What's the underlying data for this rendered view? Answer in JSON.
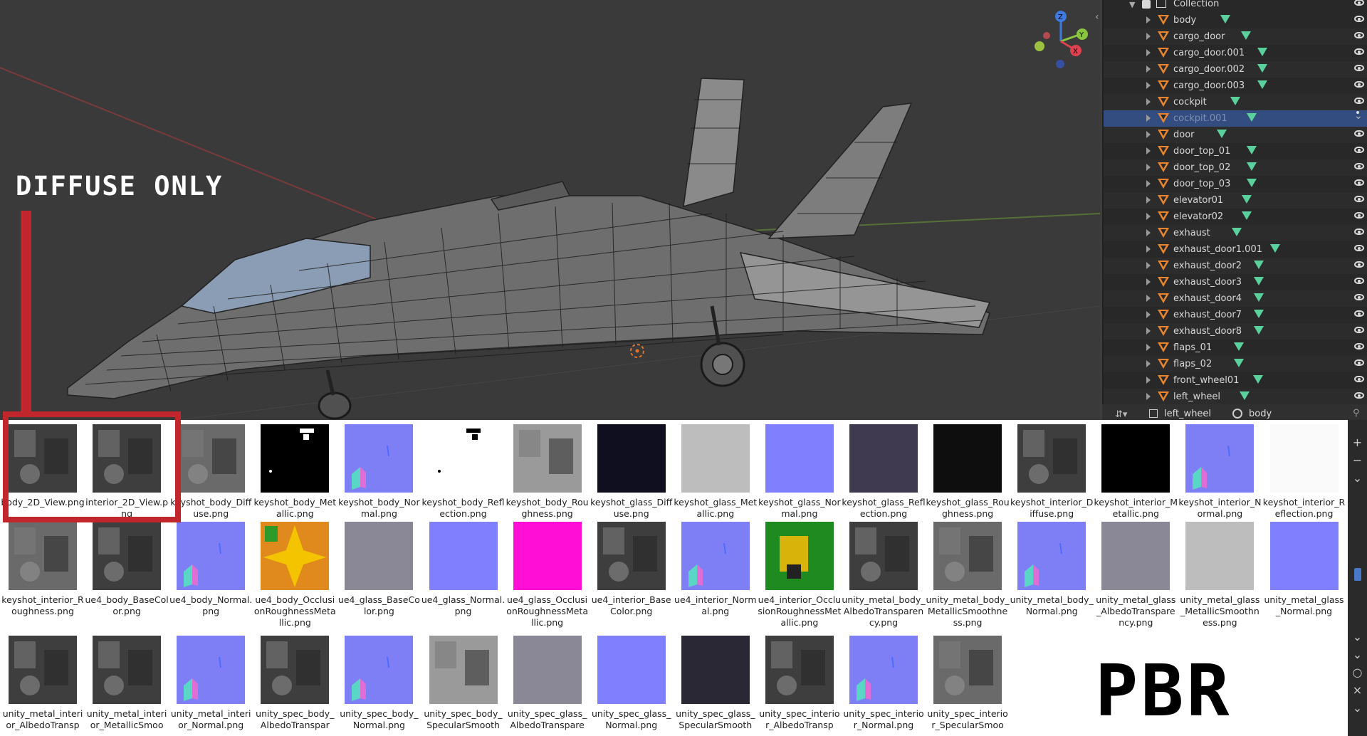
{
  "annotations": {
    "diffuse_title": "DIFFUSE ONLY",
    "pbr_title": "PBR"
  },
  "outliner": {
    "collection": "Collection",
    "items": [
      {
        "name": "body"
      },
      {
        "name": "cargo_door"
      },
      {
        "name": "cargo_door.001"
      },
      {
        "name": "cargo_door.002"
      },
      {
        "name": "cargo_door.003"
      },
      {
        "name": "cockpit"
      },
      {
        "name": "cockpit.001",
        "selected": true
      },
      {
        "name": "door"
      },
      {
        "name": "door_top_01"
      },
      {
        "name": "door_top_02"
      },
      {
        "name": "door_top_03"
      },
      {
        "name": "elevator01"
      },
      {
        "name": "elevator02"
      },
      {
        "name": "exhaust"
      },
      {
        "name": "exhaust_door1.001"
      },
      {
        "name": "exhaust_door2"
      },
      {
        "name": "exhaust_door3"
      },
      {
        "name": "exhaust_door4"
      },
      {
        "name": "exhaust_door7"
      },
      {
        "name": "exhaust_door8"
      },
      {
        "name": "flaps_01"
      },
      {
        "name": "flaps_02"
      },
      {
        "name": "front_wheel01"
      },
      {
        "name": "left_wheel"
      }
    ]
  },
  "properties_header": {
    "object": "left_wheel",
    "material": "body"
  },
  "files": {
    "row1": [
      {
        "name": "body_2D_View.png",
        "swatch": "gray_dark"
      },
      {
        "name": "interior_2D_View.png",
        "swatch": "gray_dark"
      },
      {
        "name": "keyshot_body_Diffuse.png",
        "swatch": "gray_mid"
      },
      {
        "name": "keyshot_body_Metallic.png",
        "swatch": "black_spots"
      },
      {
        "name": "keyshot_body_Normal.png",
        "swatch": "normal"
      },
      {
        "name": "keyshot_body_Reflection.png",
        "swatch": "white_spots"
      },
      {
        "name": "keyshot_body_Roughness.png",
        "swatch": "gray_light"
      },
      {
        "name": "keyshot_glass_Diffuse.png",
        "swatch": "navy_black"
      },
      {
        "name": "keyshot_glass_Metallic.png",
        "swatch": "silver"
      },
      {
        "name": "keyshot_glass_Normal.png",
        "swatch": "normal_flat"
      },
      {
        "name": "keyshot_glass_Reflection.png",
        "swatch": "slate"
      },
      {
        "name": "keyshot_glass_Roughness.png",
        "swatch": "near_black"
      },
      {
        "name": "keyshot_interior_Diffuse.png",
        "swatch": "gray_dark"
      },
      {
        "name": "keyshot_interior_Metallic.png",
        "swatch": "black"
      },
      {
        "name": "keyshot_interior_Normal.png",
        "swatch": "normal"
      },
      {
        "name": "keyshot_interior_Reflection.png",
        "swatch": "white"
      }
    ],
    "row2": [
      {
        "name": "keyshot_interior_Roughness.png",
        "swatch": "gray_mid"
      },
      {
        "name": "ue4_body_BaseColor.png",
        "swatch": "gray_dark"
      },
      {
        "name": "ue4_body_Normal.png",
        "swatch": "normal"
      },
      {
        "name": "ue4_body_OcclusionRoughnessMetallic.png",
        "swatch": "orange_green"
      },
      {
        "name": "ue4_glass_BaseColor.png",
        "swatch": "gray_purple"
      },
      {
        "name": "ue4_glass_Normal.png",
        "swatch": "normal_flat"
      },
      {
        "name": "ue4_glass_OcclusionRoughnessMetallic.png",
        "swatch": "magenta"
      },
      {
        "name": "ue4_interior_BaseColor.png",
        "swatch": "gray_dark"
      },
      {
        "name": "ue4_interior_Normal.png",
        "swatch": "normal"
      },
      {
        "name": "ue4_interior_OcclusionRoughnessMetallic.png",
        "swatch": "green_orange"
      },
      {
        "name": "unity_metal_body_AlbedoTransparency.png",
        "swatch": "gray_dark"
      },
      {
        "name": "unity_metal_body_MetallicSmoothness.png",
        "swatch": "gray_mid"
      },
      {
        "name": "unity_metal_body_Normal.png",
        "swatch": "normal"
      },
      {
        "name": "unity_metal_glass_AlbedoTransparency.png",
        "swatch": "gray_purple"
      },
      {
        "name": "unity_metal_glass_MetallicSmoothness.png",
        "swatch": "silver"
      },
      {
        "name": "unity_metal_glass_Normal.png",
        "swatch": "normal_flat"
      }
    ],
    "row3": [
      {
        "name": "unity_metal_interior_AlbedoTransp",
        "swatch": "gray_dark"
      },
      {
        "name": "unity_metal_interior_MetallicSmoo",
        "swatch": "gray_dark"
      },
      {
        "name": "unity_metal_interior_Normal.png",
        "swatch": "normal"
      },
      {
        "name": "unity_spec_body_AlbedoTranspar",
        "swatch": "gray_dark"
      },
      {
        "name": "unity_spec_body_Normal.png",
        "swatch": "normal"
      },
      {
        "name": "unity_spec_body_SpecularSmooth",
        "swatch": "gray_light"
      },
      {
        "name": "unity_spec_glass_AlbedoTranspare",
        "swatch": "gray_purple"
      },
      {
        "name": "unity_spec_glass_Normal.png",
        "swatch": "normal_flat"
      },
      {
        "name": "unity_spec_glass_SpecularSmooth",
        "swatch": "slate_dark"
      },
      {
        "name": "unity_spec_interior_AlbedoTransp",
        "swatch": "gray_dark"
      },
      {
        "name": "unity_spec_interior_Normal.png",
        "swatch": "normal"
      },
      {
        "name": "unity_spec_interior_SpecularSmoo",
        "swatch": "gray_mid"
      }
    ]
  },
  "swatches": {
    "gray_dark": "#3e3e3e",
    "gray_mid": "#6a6a6a",
    "gray_light": "#9a9a9a",
    "black_spots": "#000000",
    "white_spots": "#ffffff",
    "normal": "#7f7ff5",
    "normal_flat": "#8080ff",
    "navy_black": "#100f1f",
    "silver": "#bdbdbd",
    "slate": "#403a50",
    "near_black": "#0e0e0e",
    "black": "#000000",
    "white": "#fafafa",
    "orange_green": "#e08a1e",
    "gray_purple": "#8a8797",
    "magenta": "#ff0fd6",
    "green_orange": "#1f8a20",
    "slate_dark": "#2b2836"
  },
  "colors": {
    "annotation_red": "#c0262b",
    "selection_blue": "#334d80",
    "mesh_green": "#5ad19c",
    "object_orange": "#e8852e"
  }
}
